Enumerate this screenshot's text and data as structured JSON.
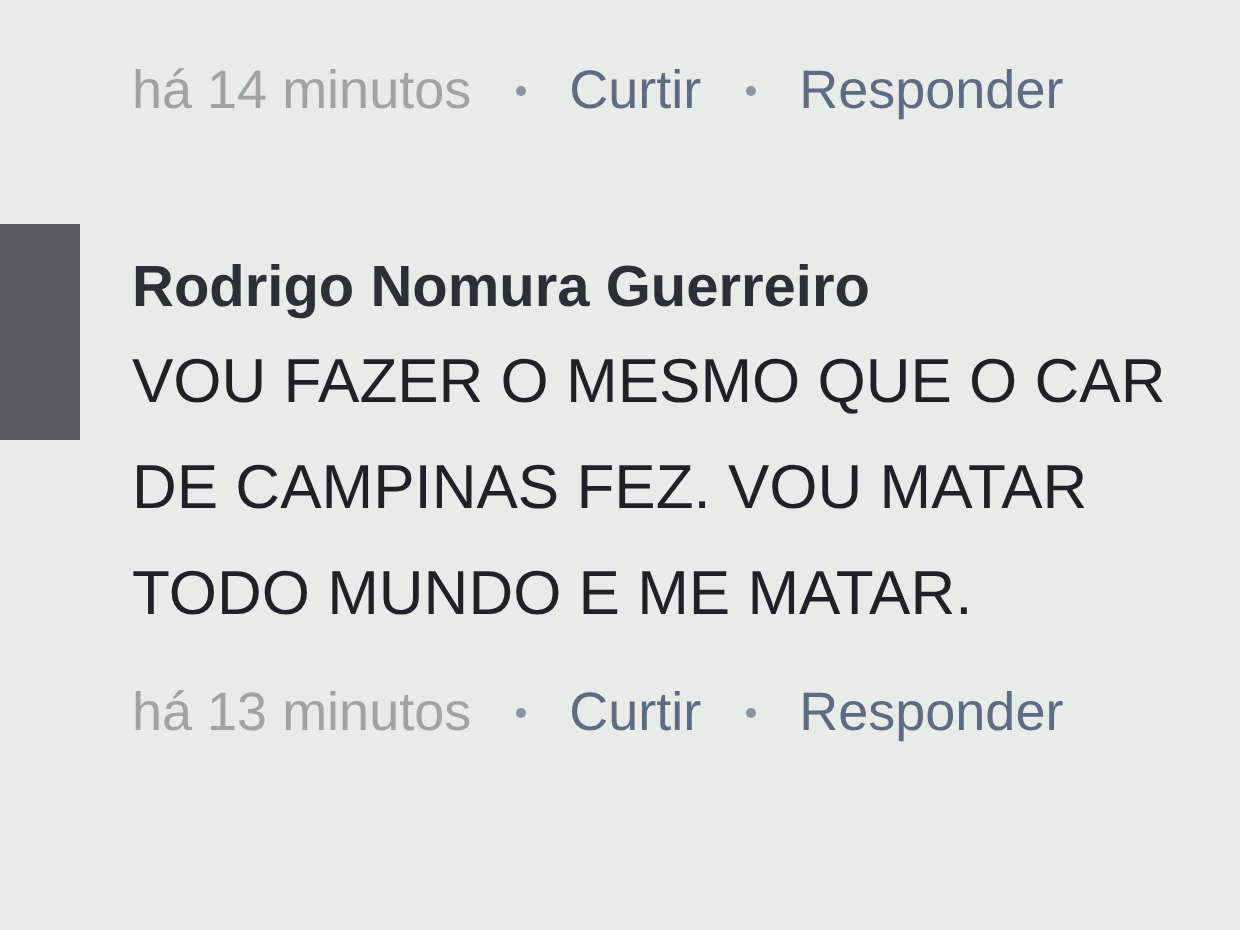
{
  "comments": [
    {
      "kind": "tail",
      "time": "há 14 minutos",
      "actions": [
        "Curtir",
        "Responder"
      ]
    },
    {
      "kind": "full",
      "author": "Rodrigo Nomura Guerreiro",
      "lines": [
        "VOU FAZER O MESMO QUE O CAR",
        "DE CAMPINAS FEZ. VOU MATAR",
        "TODO MUNDO E ME MATAR."
      ],
      "time": "há 13 minutos",
      "actions": [
        "Curtir",
        "Responder"
      ]
    }
  ]
}
